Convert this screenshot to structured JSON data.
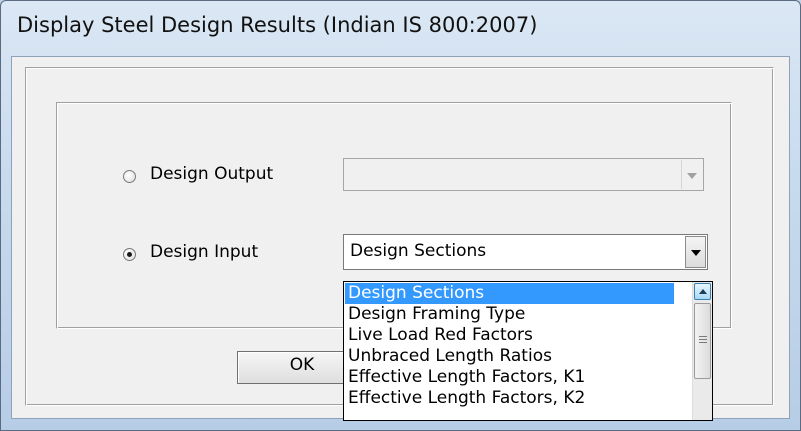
{
  "window": {
    "title": "Display Steel Design Results (Indian IS 800:2007)"
  },
  "options": [
    {
      "label": "Design Output",
      "selected": false,
      "combo_value": "",
      "combo_enabled": false
    },
    {
      "label": "Design Input",
      "selected": true,
      "combo_value": "Design Sections",
      "combo_enabled": true
    }
  ],
  "ok_button": {
    "label": "OK"
  },
  "dropdown": {
    "items": [
      "Design Sections",
      "Design Framing Type",
      "Live Load Red Factors",
      "Unbraced Length Ratios",
      "Effective Length Factors, K1",
      "Effective Length Factors, K2"
    ],
    "selected_item": "Design Sections"
  },
  "colors": {
    "selection": "#3399ff",
    "dialog_face": "#f0f0f0",
    "title_glass": "#c8dbee"
  },
  "icons": {
    "combo_arrow": "chevron-down-icon",
    "scroll_up": "scroll-up-icon",
    "scroll_grip": "grip-icon"
  }
}
